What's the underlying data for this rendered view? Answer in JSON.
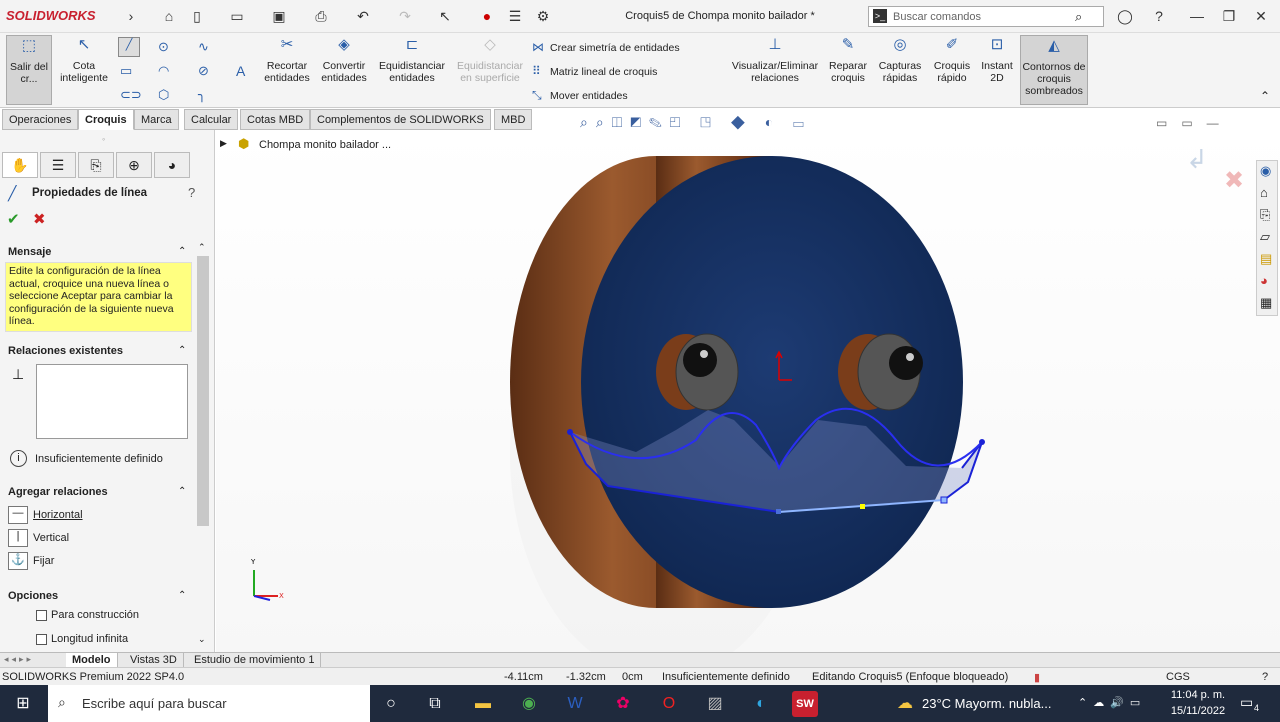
{
  "app": {
    "brand": "SOLIDWORKS",
    "title": "Croquis5 de Chompa monito bailador *"
  },
  "search": {
    "placeholder": "Buscar comandos"
  },
  "ribbon": {
    "exit": "Salir del cr...",
    "smart_dim": "Cota inteligente",
    "trim": "Recortar entidades",
    "convert": "Convertir entidades",
    "offset": "Equidistanciar entidades",
    "offset_surface": "Equidistanciar en superficie",
    "mirror": "Crear simetría de entidades",
    "linear_pattern": "Matriz lineal de croquis",
    "move": "Mover entidades",
    "display_relations": "Visualizar/Eliminar relaciones",
    "repair": "Reparar croquis",
    "quick_snaps": "Capturas rápidas",
    "rapid_sketch": "Croquis rápido",
    "instant2d": "Instant 2D",
    "shaded": "Contornos de croquis sombreados"
  },
  "tabs": [
    "Operaciones",
    "Croquis",
    "Marca",
    "Calcular",
    "Cotas MBD",
    "Complementos de SOLIDWORKS",
    "MBD"
  ],
  "panel": {
    "title": "Propiedades de línea",
    "message_head": "Mensaje",
    "message": "Edite la configuración de la línea actual, croquice una nueva línea o seleccione Aceptar para cambiar la configuración de la siguiente nueva línea.",
    "relations_head": "Relaciones existentes",
    "status": "Insuficientemente definido",
    "add_head": "Agregar relaciones",
    "horizontal": "Horizontal",
    "vertical": "Vertical",
    "fix": "Fijar",
    "options_head": "Opciones",
    "construction": "Para construcción",
    "infinite": "Longitud infinita"
  },
  "tree": {
    "root": "Chompa monito bailador ..."
  },
  "bottom_tabs": [
    "Modelo",
    "Vistas 3D",
    "Estudio de movimiento 1"
  ],
  "status": {
    "version": "SOLIDWORKS Premium 2022 SP4.0",
    "x": "-4.11cm",
    "y": "-1.32cm",
    "z": "0cm",
    "def": "Insuficientemente definido",
    "editing": "Editando Croquis5 (Enfoque bloqueado)",
    "units": "CGS"
  },
  "taskbar": {
    "search": "Escribe aquí para buscar",
    "weather": "23°C  Mayorm. nubla...",
    "time": "11:04 p. m.",
    "date": "15/11/2022",
    "notifications": "4"
  }
}
